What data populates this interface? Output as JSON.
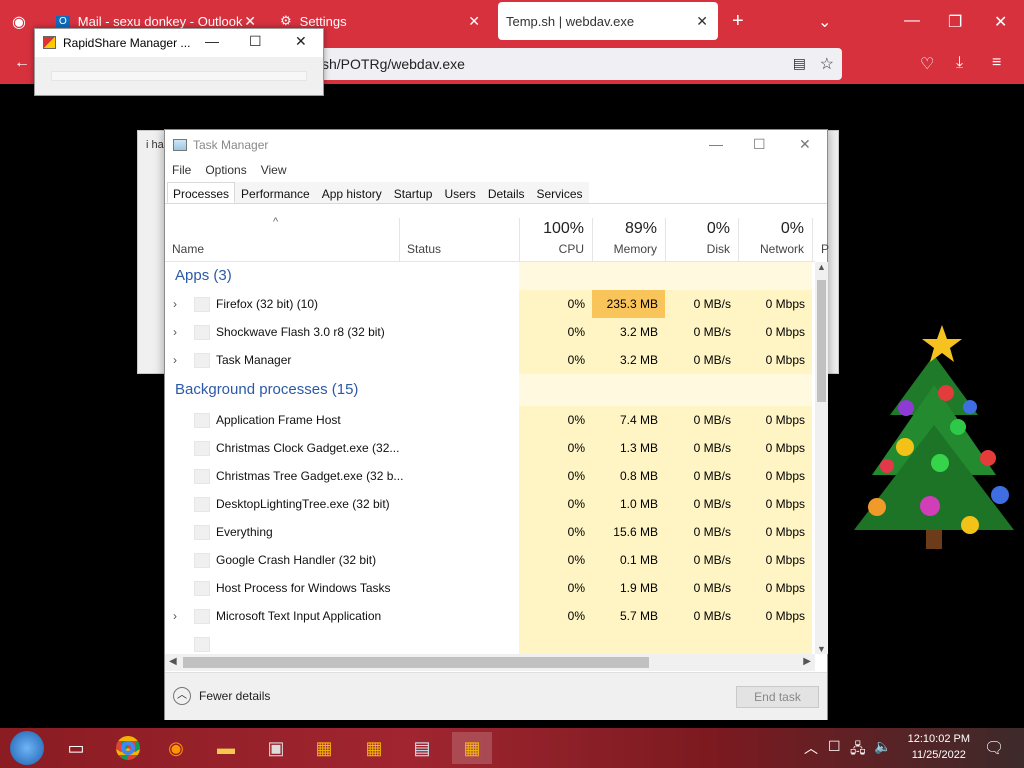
{
  "browser": {
    "tabs": [
      {
        "label": "Mail - sexu donkey - Outlook"
      },
      {
        "label": "Settings"
      },
      {
        "label": "Temp.sh | webdav.exe"
      }
    ],
    "url": "sh/POTRg/webdav.exe"
  },
  "rapidshare": {
    "title": "RapidShare Manager ..."
  },
  "taskmanager": {
    "title": "Task Manager",
    "menu": [
      "File",
      "Options",
      "View"
    ],
    "tabs": [
      "Processes",
      "Performance",
      "App history",
      "Startup",
      "Users",
      "Details",
      "Services"
    ],
    "columns": {
      "name": "Name",
      "status": "Status",
      "cpu": {
        "pct": "100%",
        "label": "CPU"
      },
      "memory": {
        "pct": "89%",
        "label": "Memory"
      },
      "disk": {
        "pct": "0%",
        "label": "Disk"
      },
      "network": {
        "pct": "0%",
        "label": "Network"
      },
      "power_partial": "P"
    },
    "groups": {
      "apps": "Apps (3)",
      "background": "Background processes (15)"
    },
    "apps": [
      {
        "name": "Firefox (32 bit) (10)",
        "cpu": "0%",
        "memory": "235.3 MB",
        "disk": "0 MB/s",
        "network": "0 Mbps"
      },
      {
        "name": "Shockwave Flash 3.0 r8 (32 bit)",
        "cpu": "0%",
        "memory": "3.2 MB",
        "disk": "0 MB/s",
        "network": "0 Mbps"
      },
      {
        "name": "Task Manager",
        "cpu": "0%",
        "memory": "3.2 MB",
        "disk": "0 MB/s",
        "network": "0 Mbps"
      }
    ],
    "background": [
      {
        "name": "Application Frame Host",
        "cpu": "0%",
        "memory": "7.4 MB",
        "disk": "0 MB/s",
        "network": "0 Mbps"
      },
      {
        "name": "Christmas Clock Gadget.exe (32...",
        "cpu": "0%",
        "memory": "1.3 MB",
        "disk": "0 MB/s",
        "network": "0 Mbps"
      },
      {
        "name": "Christmas Tree Gadget.exe (32 b...",
        "cpu": "0%",
        "memory": "0.8 MB",
        "disk": "0 MB/s",
        "network": "0 Mbps"
      },
      {
        "name": "DesktopLightingTree.exe (32 bit)",
        "cpu": "0%",
        "memory": "1.0 MB",
        "disk": "0 MB/s",
        "network": "0 Mbps"
      },
      {
        "name": "Everything",
        "cpu": "0%",
        "memory": "15.6 MB",
        "disk": "0 MB/s",
        "network": "0 Mbps"
      },
      {
        "name": "Google Crash Handler (32 bit)",
        "cpu": "0%",
        "memory": "0.1 MB",
        "disk": "0 MB/s",
        "network": "0 Mbps"
      },
      {
        "name": "Host Process for Windows Tasks",
        "cpu": "0%",
        "memory": "1.9 MB",
        "disk": "0 MB/s",
        "network": "0 Mbps"
      },
      {
        "name": "Microsoft Text Input Application",
        "cpu": "0%",
        "memory": "5.7 MB",
        "disk": "0 MB/s",
        "network": "0 Mbps"
      }
    ],
    "footer": {
      "fewer": "Fewer details",
      "end_task": "End task"
    }
  },
  "bg_dialog": {
    "frag": "i ha"
  },
  "taskbar": {
    "time": "12:10:02 PM",
    "date": "11/25/2022"
  }
}
